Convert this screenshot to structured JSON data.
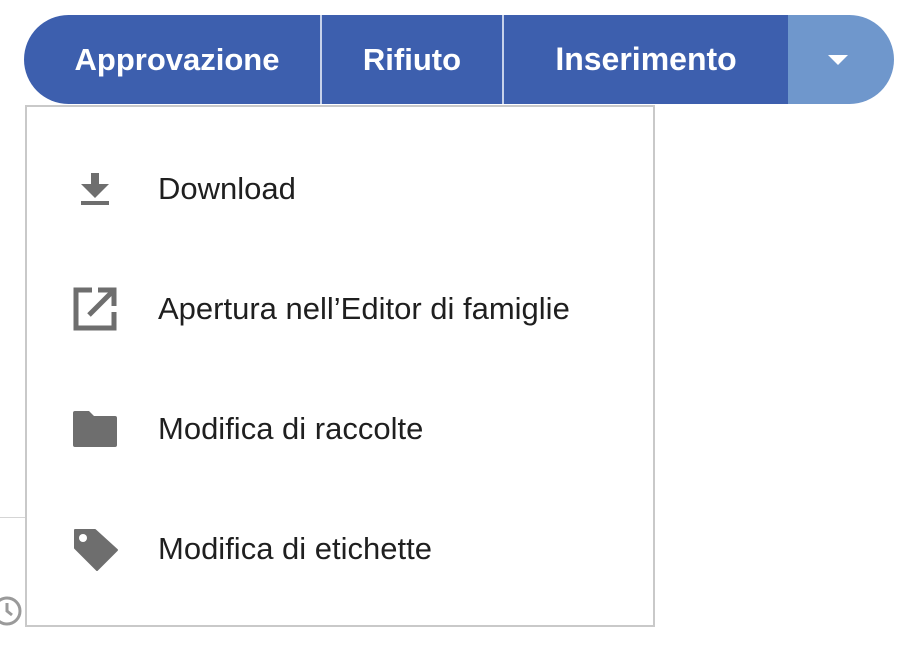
{
  "toolbar": {
    "approve_label": "Approvazione",
    "reject_label": "Rifiuto",
    "insert_label": "Inserimento",
    "more_icon": "caret-down-icon"
  },
  "menu": {
    "items": [
      {
        "label": "Download",
        "icon": "download-icon"
      },
      {
        "label": "Apertura nell’Editor di famiglie",
        "icon": "open-external-icon"
      },
      {
        "label": "Modifica di raccolte",
        "icon": "folder-icon"
      },
      {
        "label": "Modifica di etichette",
        "icon": "tag-icon"
      }
    ]
  },
  "colors": {
    "primary": "#3d5fae",
    "caret_segment": "#6f97cc",
    "icon": "#6e6e6e",
    "menu_text": "#1f1f1f",
    "menu_border": "#c9c9c9"
  }
}
